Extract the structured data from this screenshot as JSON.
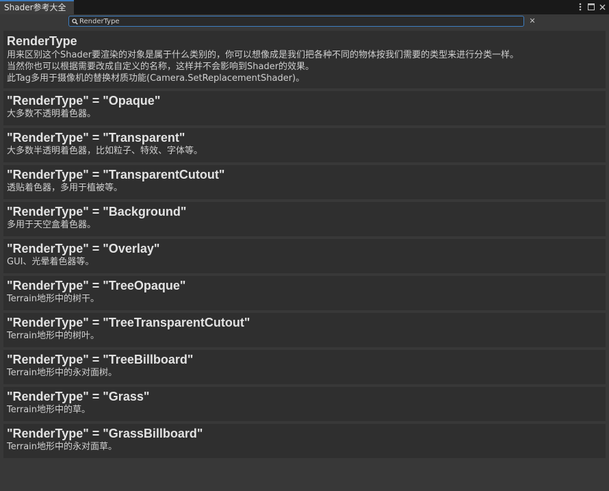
{
  "window": {
    "tab_title": "Shader参考大全"
  },
  "search": {
    "value": "RenderType",
    "placeholder": ""
  },
  "intro": {
    "title": "RenderType",
    "lines": [
      "用来区别这个Shader要渲染的对象是属于什么类别的，你可以想像成是我们把各种不同的物体按我们需要的类型来进行分类一样。",
      "当然你也可以根据需要改成自定义的名称，这样并不会影响到Shader的效果。",
      "此Tag多用于摄像机的替换材质功能(Camera.SetReplacementShader)。"
    ]
  },
  "items": [
    {
      "title": "\"RenderType\" = \"Opaque\"",
      "desc": "大多数不透明着色器。"
    },
    {
      "title": "\"RenderType\" = \"Transparent\"",
      "desc": "大多数半透明着色器，比如粒子、特效、字体等。"
    },
    {
      "title": "\"RenderType\" = \"TransparentCutout\"",
      "desc": "透贴着色器，多用于植被等。"
    },
    {
      "title": "\"RenderType\" = \"Background\"",
      "desc": "多用于天空盒着色器。"
    },
    {
      "title": "\"RenderType\" = \"Overlay\"",
      "desc": "GUI、光晕着色器等。"
    },
    {
      "title": "\"RenderType\" = \"TreeOpaque\"",
      "desc": "Terrain地形中的树干。"
    },
    {
      "title": "\"RenderType\" = \"TreeTransparentCutout\"",
      "desc": "Terrain地形中的树叶。"
    },
    {
      "title": "\"RenderType\" = \"TreeBillboard\"",
      "desc": "Terrain地形中的永对面树。"
    },
    {
      "title": "\"RenderType\" = \"Grass\"",
      "desc": "Terrain地形中的草。"
    },
    {
      "title": "\"RenderType\" = \"GrassBillboard\"",
      "desc": "Terrain地形中的永对面草。"
    }
  ],
  "icons": {
    "menu": "kebab-menu-icon",
    "maximize": "maximize-icon",
    "close": "close-icon",
    "search": "search-icon",
    "clear": "clear-search-icon"
  },
  "colors": {
    "accent": "#3a79bb",
    "background": "#383838",
    "card": "#2f2f2f",
    "tabstrip": "#191919"
  }
}
